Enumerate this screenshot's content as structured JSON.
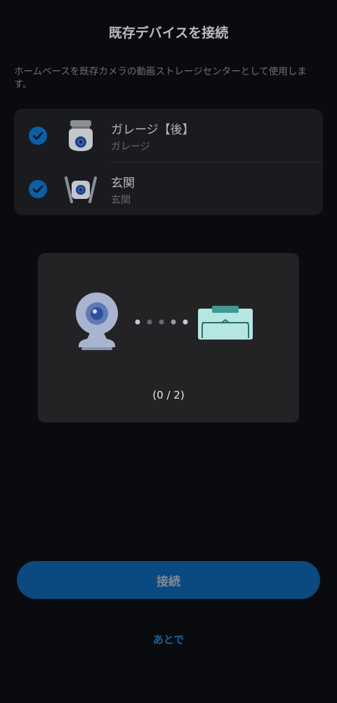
{
  "header": {
    "title": "既存デバイスを接続"
  },
  "description": "ホームベースを既存カメラの動画ストレージセンターとして使用します。",
  "devices": [
    {
      "name": "ガレージ【後】",
      "location": "ガレージ",
      "checked": true,
      "icon": "pan-tilt-camera-icon"
    },
    {
      "name": "玄関",
      "location": "玄関",
      "checked": true,
      "icon": "wall-camera-icon"
    }
  ],
  "connection": {
    "progress_text": "(0 / 2)",
    "completed": 0,
    "total": 2
  },
  "actions": {
    "connect_label": "接続",
    "later_label": "あとで"
  },
  "colors": {
    "accent": "#0b4a80",
    "check": "#0b5fa5",
    "background": "#0a0b0e"
  }
}
